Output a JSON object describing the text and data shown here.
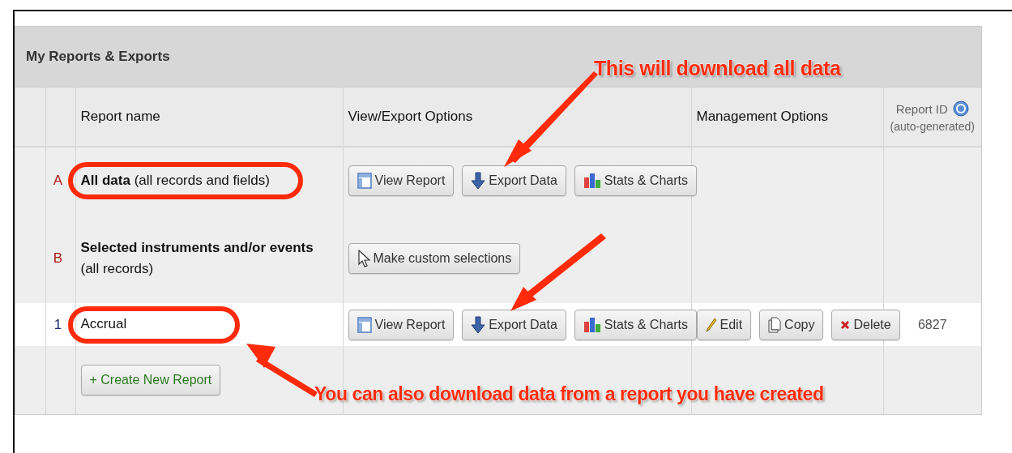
{
  "panel": {
    "title": "My Reports & Exports"
  },
  "table": {
    "columns": [
      {
        "label": "Report name"
      },
      {
        "label": "View/Export Options"
      },
      {
        "label": "Management Options"
      },
      {
        "label": "Report ID",
        "note": "(auto-generated)"
      }
    ],
    "rows": [
      {
        "marker": "A",
        "kind": "preset",
        "circled": true,
        "name": "**All data** (all records and fields)",
        "view_buttons": [
          {
            "kind": "view",
            "label": "View Report"
          },
          {
            "kind": "export",
            "label": "Export Data"
          },
          {
            "kind": "stats",
            "label": "Stats & Charts"
          }
        ]
      },
      {
        "marker": "B",
        "kind": "preset",
        "circled": false,
        "name": "**Selected instruments and/or events** (all records)",
        "view_buttons": [
          {
            "kind": "select",
            "label": "Make custom selections"
          }
        ]
      },
      {
        "marker": "1",
        "kind": "custom",
        "circled": true,
        "name": "Accrual",
        "view_buttons": [
          {
            "kind": "view",
            "label": "View Report"
          },
          {
            "kind": "export",
            "label": "Export Data"
          },
          {
            "kind": "stats",
            "label": "Stats & Charts"
          }
        ],
        "manage_buttons": [
          {
            "kind": "edit",
            "label": "Edit"
          },
          {
            "kind": "copy",
            "label": "Copy"
          },
          {
            "kind": "delete",
            "label": "Delete"
          }
        ],
        "report_id": "6827"
      }
    ],
    "create_button": "+ Create New Report"
  },
  "annotations": [
    {
      "text": "This will download all data"
    },
    {
      "text": "You can also download data from a report you have created"
    }
  ]
}
